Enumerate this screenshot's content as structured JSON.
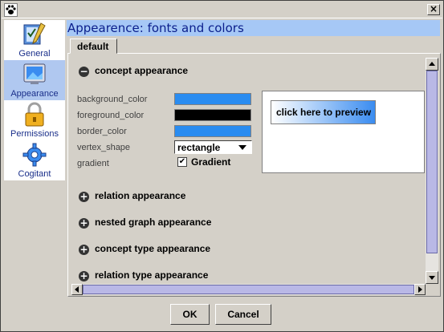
{
  "window": {
    "close_glyph": "×",
    "app_icon": "paw-icon"
  },
  "sidebar": {
    "items": [
      {
        "label": "General",
        "icon": "general-pen-icon"
      },
      {
        "label": "Appearance",
        "icon": "appearance-monitor-icon",
        "selected": true
      },
      {
        "label": "Permissions",
        "icon": "padlock-icon"
      },
      {
        "label": "Cogitant",
        "icon": "gear-icon"
      }
    ]
  },
  "header": {
    "title": "Appearence: fonts and colors"
  },
  "tabs": [
    {
      "label": "default"
    }
  ],
  "concept_section": {
    "title": "concept appearance",
    "background_color_label": "background_color",
    "background_color": "#2a8cf0",
    "foreground_color_label": "foreground_color",
    "foreground_color": "#000000",
    "border_color_label": "border_color",
    "border_color": "#2a8cf0",
    "vertex_shape_label": "vertex_shape",
    "vertex_shape_value": "rectangle",
    "gradient_label": "gradient",
    "gradient_check_label": "Gradient",
    "gradient_checked": true,
    "preview_label": "click here to preview"
  },
  "collapsed_sections": [
    {
      "title": "relation appearance"
    },
    {
      "title": "nested graph appearance"
    },
    {
      "title": "concept type appearance"
    },
    {
      "title": "relation type appearance"
    }
  ],
  "buttons": {
    "ok": "OK",
    "cancel": "Cancel"
  }
}
